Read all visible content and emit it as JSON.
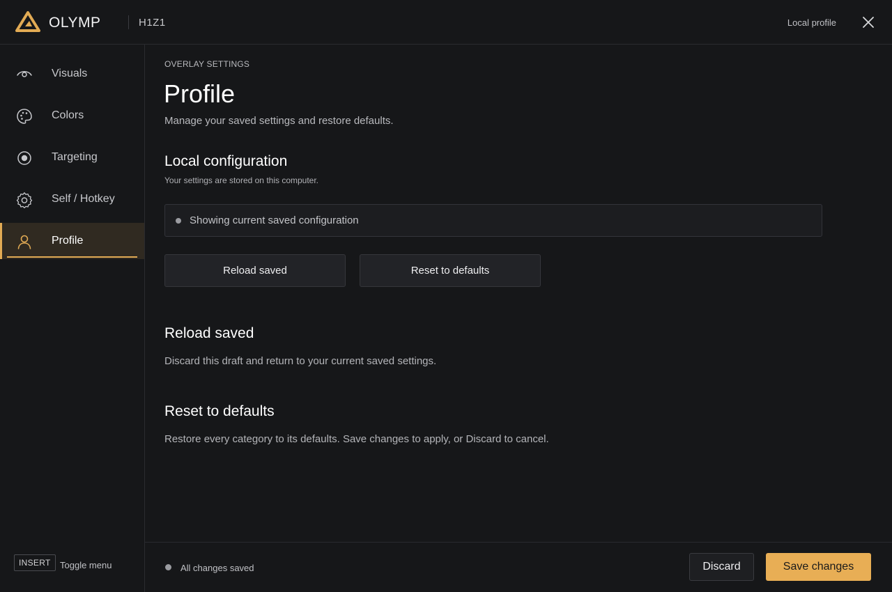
{
  "header": {
    "brand": "OLYMP",
    "game": "H1Z1",
    "profile_label": "Local profile",
    "accent_color": "#e2ab54"
  },
  "sidebar": {
    "items": [
      {
        "label": "Visuals",
        "icon": "eye-icon",
        "active": false
      },
      {
        "label": "Colors",
        "icon": "palette-icon",
        "active": false
      },
      {
        "label": "Targeting",
        "icon": "target-icon",
        "active": false
      },
      {
        "label": "Self / Hotkey",
        "icon": "gear-icon",
        "active": false
      },
      {
        "label": "Profile",
        "icon": "user-icon",
        "active": true
      }
    ],
    "hotkey": "INSERT",
    "hotkey_label": "Toggle menu"
  },
  "main": {
    "eyebrow": "OVERLAY SETTINGS",
    "title": "Profile",
    "subtitle": "Manage your saved settings and restore defaults.",
    "local": {
      "title": "Local configuration",
      "desc": "Your settings are stored on this computer.",
      "status": "Showing current saved configuration"
    },
    "buttons": {
      "reload": "Reload saved",
      "reset": "Reset to defaults"
    },
    "reload_section": {
      "title": "Reload saved",
      "desc": "Discard this draft and return to your current saved settings."
    },
    "reset_section": {
      "title": "Reset to defaults",
      "desc": "Restore every category to its defaults. Save changes to apply, or Discard to cancel."
    }
  },
  "footer": {
    "status": "All changes saved",
    "discard": "Discard",
    "save": "Save changes"
  }
}
